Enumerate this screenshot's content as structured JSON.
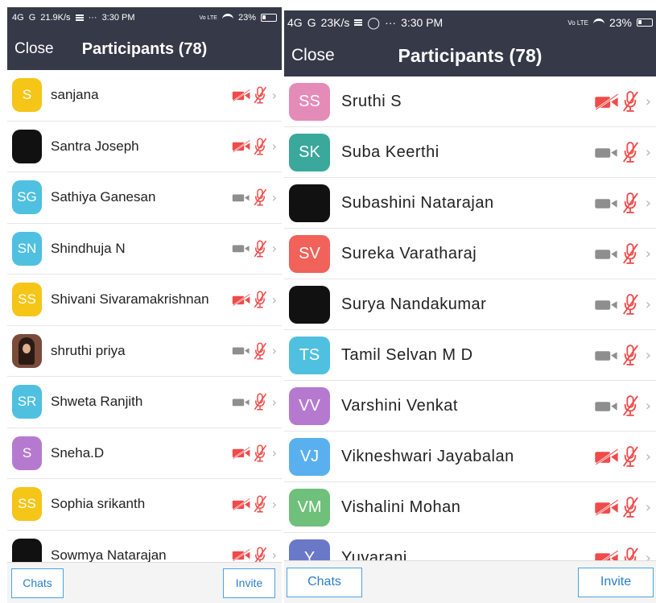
{
  "colors": {
    "header_bg": "#353948",
    "muted_red": "#f04a4a",
    "video_gray": "#8e8e8e",
    "button_blue": "#2a7fc8"
  },
  "left": {
    "status": {
      "network": "4G",
      "signal2": "G",
      "speed": "21.9K/s",
      "more": "···",
      "time": "3:30 PM",
      "lte": "Vo LTE",
      "battery": "23%"
    },
    "header": {
      "close": "Close",
      "title": "Participants (78)"
    },
    "participants": [
      {
        "initials": "S",
        "name": "sanjana",
        "color": "#f5c518",
        "video_off": true
      },
      {
        "initials": "",
        "name": "Santra Joseph",
        "color": "#111111",
        "video_off": true,
        "photo": "dark"
      },
      {
        "initials": "SG",
        "name": "Sathiya Ganesan",
        "color": "#4fc0e0",
        "video_off": false
      },
      {
        "initials": "SN",
        "name": "Shindhuja N",
        "color": "#4fc0e0",
        "video_off": false
      },
      {
        "initials": "SS",
        "name": "Shivani Sivaramakrishnan",
        "color": "#f5c518",
        "video_off": true
      },
      {
        "initials": "",
        "name": "shruthi priya",
        "color": "#7a4a3a",
        "video_off": false,
        "photo": "portrait"
      },
      {
        "initials": "SR",
        "name": "Shweta Ranjith",
        "color": "#4fc0e0",
        "video_off": false
      },
      {
        "initials": "S",
        "name": "Sneha.D",
        "color": "#b57ad0",
        "video_off": true
      },
      {
        "initials": "SS",
        "name": "Sophia srikanth",
        "color": "#f5c518",
        "video_off": true
      },
      {
        "initials": "",
        "name": "Sowmya Natarajan",
        "color": "#111111",
        "video_off": true,
        "photo": "dark"
      }
    ],
    "footer": {
      "chats": "Chats",
      "invite": "Invite"
    }
  },
  "right": {
    "status": {
      "network": "4G",
      "signal2": "G",
      "speed": "23K/s",
      "more": "···",
      "time": "3:30 PM",
      "lte": "Vo LTE",
      "battery": "23%"
    },
    "header": {
      "close": "Close",
      "title": "Participants (78)"
    },
    "participants": [
      {
        "initials": "SS",
        "name": "Sruthi S",
        "color": "#e58bb8",
        "video_off": true
      },
      {
        "initials": "SK",
        "name": "Suba Keerthi",
        "color": "#3aa89a",
        "video_off": false
      },
      {
        "initials": "",
        "name": "Subashini Natarajan",
        "color": "#000000",
        "video_off": false,
        "photo": "dark"
      },
      {
        "initials": "SV",
        "name": "Sureka Varatharaj",
        "color": "#f0625a",
        "video_off": false
      },
      {
        "initials": "",
        "name": "Surya Nandakumar",
        "color": "#000000",
        "video_off": false,
        "photo": "dark"
      },
      {
        "initials": "TS",
        "name": "Tamil Selvan M D",
        "color": "#4fc0e0",
        "video_off": false
      },
      {
        "initials": "VV",
        "name": "Varshini Venkat",
        "color": "#b57ad0",
        "video_off": false
      },
      {
        "initials": "VJ",
        "name": "Vikneshwari Jayabalan",
        "color": "#5ab0ef",
        "video_off": true
      },
      {
        "initials": "VM",
        "name": "Vishalini Mohan",
        "color": "#6fc07a",
        "video_off": true
      },
      {
        "initials": "Y",
        "name": "Yuvarani",
        "color": "#6a78c8",
        "video_off": true
      }
    ],
    "footer": {
      "chats": "Chats",
      "invite": "Invite"
    }
  }
}
